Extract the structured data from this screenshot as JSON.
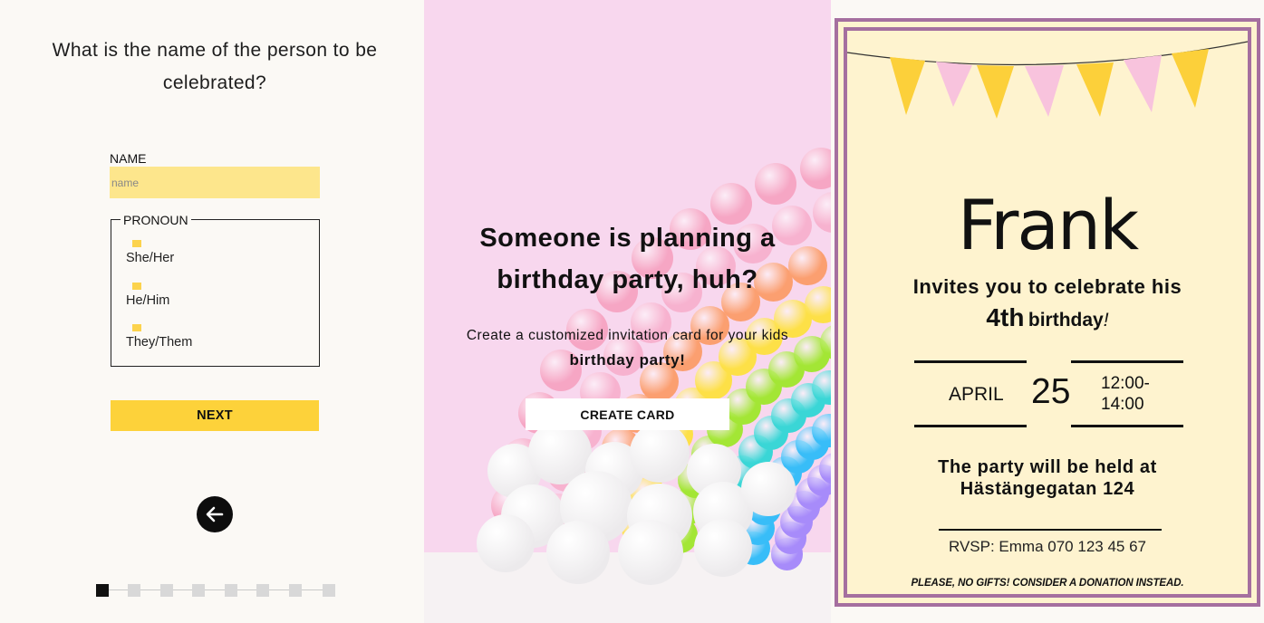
{
  "form": {
    "question": "What is the name of the person to be celebrated?",
    "name_label": "NAME",
    "name_placeholder": "name",
    "name_value": "",
    "pronoun_legend": "PRONOUN",
    "pronouns": [
      "She/Her",
      "He/Him",
      "They/Them"
    ],
    "next_label": "NEXT",
    "back_icon": "arrow-left-icon",
    "progress": {
      "total_steps": 8,
      "current_step": 1
    }
  },
  "landing": {
    "headline": "Someone is planning a birthday party, huh?",
    "subtitle_prefix": "Create a customized invitation card for your kids",
    "subtitle_bold": "birthday party!",
    "create_label": "CREATE CARD"
  },
  "card": {
    "name": "Frank",
    "invite_line": "Invites you to celebrate his",
    "age": "4th",
    "birthday_word": "birthday",
    "exclamation": "!",
    "month": "APRIL",
    "day": "25",
    "time": "12:00-14:00",
    "time_start": "12:00-",
    "time_end": "14:00",
    "place_line1": "The party will be held at",
    "place_line2": "Hästängegatan 124",
    "rsvp": "RVSP: Emma 070 123 45 67",
    "note": "PLEASE, NO GIFTS! CONSIDER A DONATION INSTEAD."
  },
  "colors": {
    "accent_yellow": "#fdd23a",
    "input_yellow": "#fde68c",
    "card_background": "#fef3cf",
    "card_border": "#a56f9f",
    "flag_yellow": "#fcd03a",
    "flag_pink": "#f8c3dd",
    "landing_background": "#f8d7ee"
  }
}
